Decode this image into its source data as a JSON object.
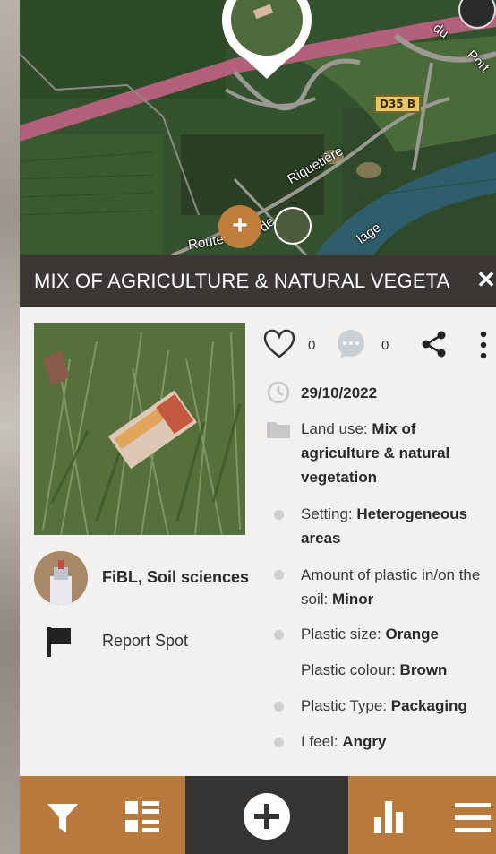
{
  "map": {
    "labels": [
      "du",
      "Port",
      "Riquetière",
      "Route",
      "de",
      "lage"
    ],
    "road_sign": "D35 B",
    "plus_label": "+"
  },
  "title": "MIX OF AGRICULTURE & NATURAL VEGETA",
  "close_label": "✕",
  "actions": {
    "likes": "0",
    "comments": "0"
  },
  "date": "29/10/2022",
  "details": {
    "land_use_label": "Land use: ",
    "land_use_value": "Mix of agriculture & natural vegetation",
    "setting_label": "Setting: ",
    "setting_value": "Heterogeneous areas",
    "amount_label": "Amount of plastic in/on the soil: ",
    "amount_value": "Minor",
    "size_label": "Plastic size: ",
    "size_value": "Orange",
    "colour_label": "Plastic colour: ",
    "colour_value": "Brown",
    "type_label": "Plastic Type: ",
    "type_value": "Packaging",
    "feel_label": "I feel: ",
    "feel_value": "Angry"
  },
  "author": "FiBL, Soil sciences",
  "report_label": "Report Spot",
  "colors": {
    "accent": "#b97b3d",
    "dark": "#3a3734",
    "panel": "#f2f1ef"
  },
  "nav": {
    "icons": [
      "filter-icon",
      "list-icon",
      "add-icon",
      "stats-icon",
      "menu-icon"
    ]
  }
}
